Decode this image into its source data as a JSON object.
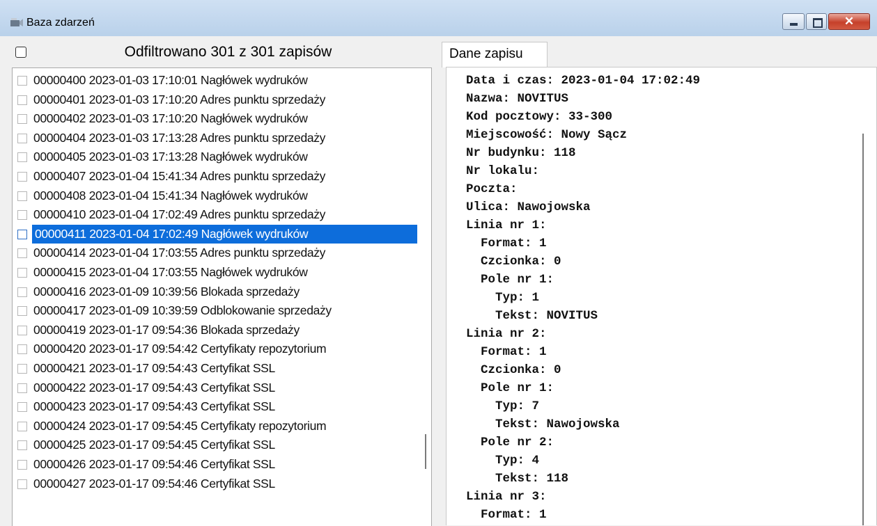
{
  "window": {
    "title": "Baza zdarzeń"
  },
  "list_header": {
    "summary": "Odfiltrowano 301 z 301 zapisów"
  },
  "records": [
    {
      "text": "00000400 2023-01-03 17:10:01 Nagłówek wydruków",
      "selected": false
    },
    {
      "text": "00000401 2023-01-03 17:10:20 Adres punktu sprzedaży",
      "selected": false
    },
    {
      "text": "00000402 2023-01-03 17:10:20 Nagłówek wydruków",
      "selected": false
    },
    {
      "text": "00000404 2023-01-03 17:13:28 Adres punktu sprzedaży",
      "selected": false
    },
    {
      "text": "00000405 2023-01-03 17:13:28 Nagłówek wydruków",
      "selected": false
    },
    {
      "text": "00000407 2023-01-04 15:41:34 Adres punktu sprzedaży",
      "selected": false
    },
    {
      "text": "00000408 2023-01-04 15:41:34 Nagłówek wydruków",
      "selected": false
    },
    {
      "text": "00000410 2023-01-04 17:02:49 Adres punktu sprzedaży",
      "selected": false
    },
    {
      "text": "00000411 2023-01-04 17:02:49 Nagłówek wydruków",
      "selected": true
    },
    {
      "text": "00000414 2023-01-04 17:03:55 Adres punktu sprzedaży",
      "selected": false
    },
    {
      "text": "00000415 2023-01-04 17:03:55 Nagłówek wydruków",
      "selected": false
    },
    {
      "text": "00000416 2023-01-09 10:39:56 Blokada sprzedaży",
      "selected": false
    },
    {
      "text": "00000417 2023-01-09 10:39:59 Odblokowanie sprzedaży",
      "selected": false
    },
    {
      "text": "00000419 2023-01-17 09:54:36 Blokada sprzedaży",
      "selected": false
    },
    {
      "text": "00000420 2023-01-17 09:54:42 Certyfikaty repozytorium",
      "selected": false
    },
    {
      "text": "00000421 2023-01-17 09:54:43 Certyfikat SSL",
      "selected": false
    },
    {
      "text": "00000422 2023-01-17 09:54:43 Certyfikat SSL",
      "selected": false
    },
    {
      "text": "00000423 2023-01-17 09:54:43 Certyfikat SSL",
      "selected": false
    },
    {
      "text": "00000424 2023-01-17 09:54:45 Certyfikaty repozytorium",
      "selected": false
    },
    {
      "text": "00000425 2023-01-17 09:54:45 Certyfikat SSL",
      "selected": false
    },
    {
      "text": "00000426 2023-01-17 09:54:46 Certyfikat SSL",
      "selected": false
    },
    {
      "text": "00000427 2023-01-17 09:54:46 Certyfikat SSL",
      "selected": false
    }
  ],
  "detail_tab": {
    "label": "Dane zapisu"
  },
  "detail_lines": [
    "Data i czas: 2023-01-04 17:02:49",
    "Nazwa: NOVITUS",
    "Kod pocztowy: 33-300",
    "Miejscowość: Nowy Sącz",
    "Nr budynku: 118",
    "Nr lokalu:",
    "Poczta:",
    "Ulica: Nawojowska",
    "Linia nr 1:",
    "  Format: 1",
    "  Czcionka: 0",
    "  Pole nr 1:",
    "    Typ: 1",
    "    Tekst: NOVITUS",
    "Linia nr 2:",
    "  Format: 1",
    "  Czcionka: 0",
    "  Pole nr 1:",
    "    Typ: 7",
    "    Tekst: Nawojowska",
    "  Pole nr 2:",
    "    Typ: 4",
    "    Tekst: 118",
    "Linia nr 3:",
    "  Format: 1"
  ],
  "icons": {
    "app": "event-database-icon",
    "minimize": "minimize-icon",
    "maximize": "maximize-icon",
    "close": "close-icon"
  },
  "colors": {
    "selection": "#0d6ddb",
    "close_button": "#c6402a",
    "titlebar": "#b9d1ea"
  }
}
